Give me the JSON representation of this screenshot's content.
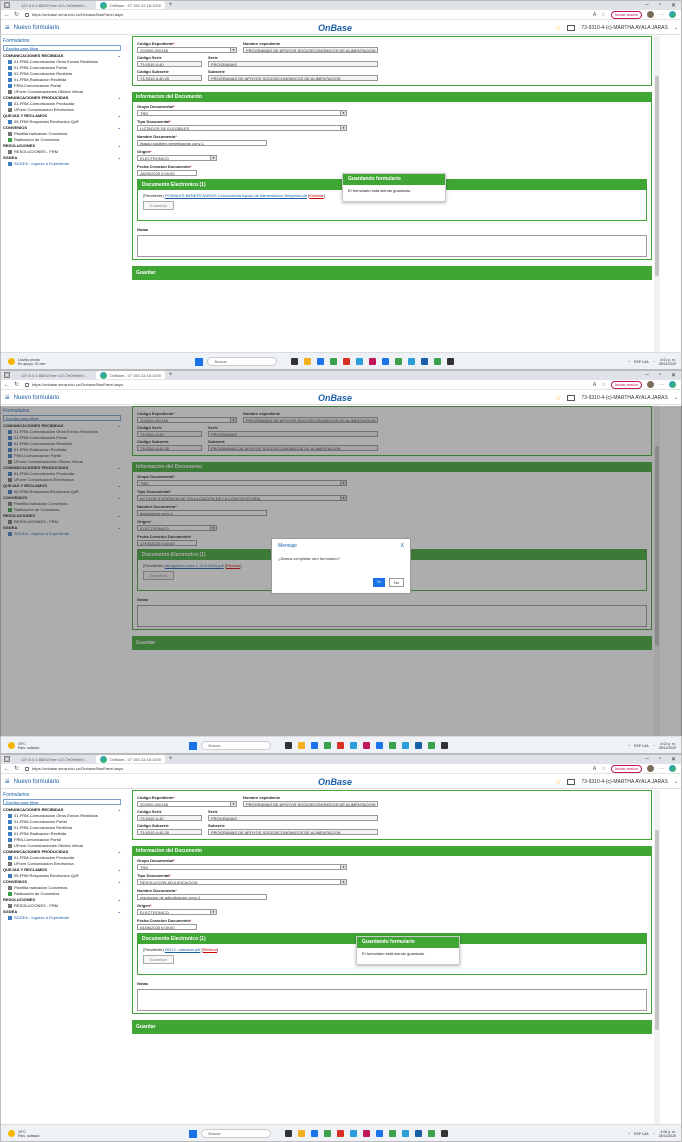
{
  "browser": {
    "tab1": "127.0.0.1:8020/?ver=4.0-7e00eeb0…",
    "tab2": "OnBase - 07 160 22:18:1000",
    "url": "https://onbase.sena.edu.co/Onbase/NavPanel.aspx",
    "signin_label": "Iniciar sesión"
  },
  "header": {
    "new_form": "Nuevo formulario",
    "logo": "OnBase",
    "user": "73-9310-4-(c)-MARTHA AYALA JARAS"
  },
  "sidebar": {
    "title": "Formularios",
    "search_placeholder": "Escriba para filtrar",
    "cat_recibidas": "COMUNICACIONES RECIBIDAS",
    "r1": "01-FRM-Comunicacion Otros Envios Recibidos",
    "r2": "01-FRM-Comunicacion Portal",
    "r3": "01-FRM-Comunicacion Recibida",
    "r4": "01-FRM-Radicacion Recibida",
    "r5": "FRM-Comunicacion Portal",
    "r6": "UForm Comunicaciones Oficina Virtual",
    "cat_producidas": "COMUNICACIONES PRODUCIDAS",
    "p1": "01-FRM-Comunicacion Producida",
    "p2": "UForm Comunicacion Electronica",
    "cat_quejas": "QUEJAS Y RECLAMOS",
    "q1": "05-FRM Respuesta Electronica QyR",
    "cat_convenios": "CONVENIOS",
    "c1": "Plantilla radicacion Convenios",
    "c2": "Radicación de Convenios",
    "cat_resoluciones": "RESOLUCIONES",
    "res1": "RESOLUCIONES - FRM",
    "cat_sgdea": "SGDEA",
    "s1": "SGDEA - Ingreso a Expediente"
  },
  "form": {
    "lbl_codigo_exp": "Código Expediente",
    "lbl_nombre_exp": "Nombre expediente",
    "codigo_exp": "202500-000165",
    "nombre_exp": "PROGRAMAS DE APOYOS SOCIOECONOMICOS DE ALIMENTACION 1 Y 2 2025",
    "lbl_codigo_serie": "Código Serie",
    "lbl_serie": "Serie",
    "codigo_serie": "73.9310.4-40",
    "serie": "PROGRAMAS",
    "lbl_codigo_subserie": "Código Subserie",
    "lbl_subserie": "Subserie",
    "codigo_subserie": "73.9310.4-40.20",
    "subserie": "PROGRAMAS DE APOYOS SOCIOECONOMICOS DE ALIMENTACION",
    "section_doc": "Informacion del Documento",
    "lbl_grupo": "Grupo Documental",
    "grupo": "TRD",
    "lbl_tipo": "Tipo Documental",
    "lbl_nombre_doc": "Nombre Documento",
    "lbl_origen": "Origen",
    "origen": "ELECTRONICO",
    "lbl_fecha": "Fecha Creacion Documento",
    "section_electronico": "Documento Electronico (1)",
    "pendiente": "(Pendiente)",
    "eliminar": "Eliminar",
    "btn_examinar": "Examinar",
    "lbl_notas": "Notas",
    "btn_guardar": "Guardar"
  },
  "shot1": {
    "tipo": "LISTADOS DE ELEGIBLES",
    "nombre_doc": "listado posibles beneficiarios conv-1",
    "fecha": "28/05/2025 0:00:00",
    "archivo": "POSIBLES BENEFICIARIOS Convocatoria Apoyo de Alimentación Temporal.pdf",
    "weather_line1": "Llovido pronto",
    "weather_line2": "En apoyo: 20 mm",
    "time": "4:01 p. m.",
    "date": "28/11/2025"
  },
  "shot2": {
    "tipo": "ACTA DE EVIDENCIA DE DIVULGACION DE LA CONVOCATORIA",
    "nombre_doc": "divulgacion conv-1",
    "fecha": "17/05/2025 0:00:00",
    "archivo": "divulgacion conv-1 11-5-2025.pdf",
    "weather_line1": "19°C",
    "weather_line2": "Parc. soleado",
    "time": "4:02 p. m.",
    "date": "28/11/2025"
  },
  "shot3": {
    "tipo": "RESOLUCION ADJUDICACION",
    "nombre_doc": "resolucion de adjudicacion conv-1",
    "fecha": "04/06/2025 0:00:00",
    "archivo": "00571 -radicada.pdf",
    "weather_line1": "19°C",
    "weather_line2": "Parc. soleado",
    "time": "4:06 p. m.",
    "date": "28/11/2025"
  },
  "toast": {
    "title": "Guardando formulario",
    "body": "El formulario está siendo guardado."
  },
  "modal": {
    "title": "Mensaje",
    "close": "X",
    "body": "¿Desea completar otro formulario?",
    "yes": "Sí",
    "no": "No"
  },
  "taskbar": {
    "search": "Buscar",
    "lang": "ESP LAA"
  },
  "colors": {
    "accent_green": "#3fa535",
    "brand_blue": "#1a5ea8"
  }
}
